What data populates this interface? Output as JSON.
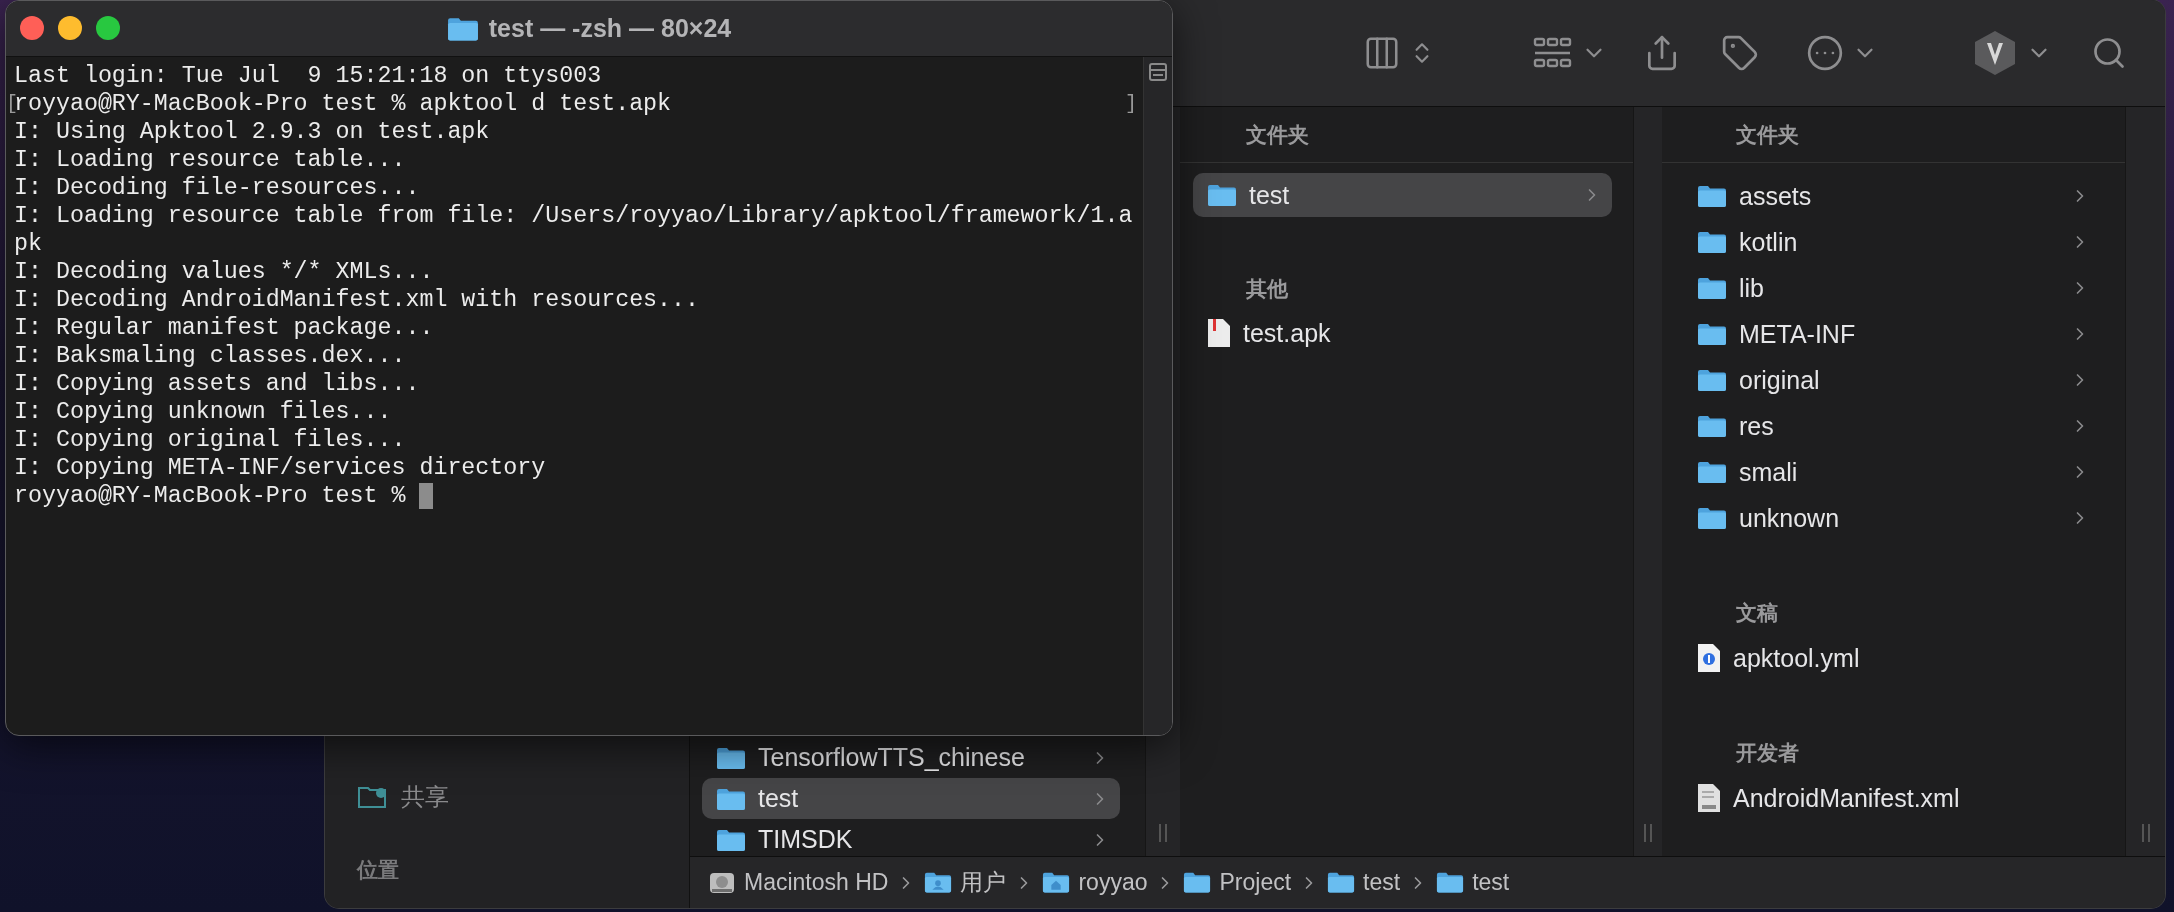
{
  "terminal": {
    "title": "test — -zsh — 80×24",
    "lines": [
      {
        "kind": "output",
        "text": "Last login: Tue Jul  9 15:21:18 on ttys003"
      },
      {
        "kind": "marked",
        "text": "royyao@RY-MacBook-Pro test % apktool d test.apk",
        "mark_open": "[",
        "mark_close": "]"
      },
      {
        "kind": "output",
        "text": "I: Using Apktool 2.9.3 on test.apk"
      },
      {
        "kind": "output",
        "text": "I: Loading resource table..."
      },
      {
        "kind": "output",
        "text": "I: Decoding file-resources..."
      },
      {
        "kind": "output",
        "text": "I: Loading resource table from file: /Users/royyao/Library/apktool/framework/1.apk"
      },
      {
        "kind": "output",
        "text": "I: Decoding values */* XMLs..."
      },
      {
        "kind": "output",
        "text": "I: Decoding AndroidManifest.xml with resources..."
      },
      {
        "kind": "output",
        "text": "I: Regular manifest package..."
      },
      {
        "kind": "output",
        "text": "I: Baksmaling classes.dex..."
      },
      {
        "kind": "output",
        "text": "I: Copying assets and libs..."
      },
      {
        "kind": "output",
        "text": "I: Copying unknown files..."
      },
      {
        "kind": "output",
        "text": "I: Copying original files..."
      },
      {
        "kind": "output",
        "text": "I: Copying META-INF/services directory"
      },
      {
        "kind": "prompt",
        "text": "royyao@RY-MacBook-Pro test % ",
        "cursor": true
      }
    ]
  },
  "finder": {
    "sidebar": [
      {
        "kind": "item",
        "label": "共享"
      },
      {
        "kind": "header",
        "label": "位置"
      }
    ],
    "columns": [
      {
        "sections": [
          {
            "items": [
              {
                "kind": "folder",
                "name": "TensorflowTTS_chinese",
                "selected": false
              },
              {
                "kind": "folder",
                "name": "test",
                "selected": true
              },
              {
                "kind": "folder",
                "name": "TIMSDK",
                "selected": false
              }
            ]
          }
        ]
      },
      {
        "sections": [
          {
            "header": "文件夹",
            "items": [
              {
                "kind": "folder",
                "name": "test",
                "selected": true
              }
            ]
          },
          {
            "header": "其他",
            "items": [
              {
                "kind": "apk",
                "name": "test.apk",
                "selected": false
              }
            ]
          }
        ]
      },
      {
        "sections": [
          {
            "header": "文件夹",
            "items": [
              {
                "kind": "folder",
                "name": "assets",
                "selected": false
              },
              {
                "kind": "folder",
                "name": "kotlin",
                "selected": false
              },
              {
                "kind": "folder",
                "name": "lib",
                "selected": false
              },
              {
                "kind": "folder",
                "name": "META-INF",
                "selected": false
              },
              {
                "kind": "folder",
                "name": "original",
                "selected": false
              },
              {
                "kind": "folder",
                "name": "res",
                "selected": false
              },
              {
                "kind": "folder",
                "name": "smali",
                "selected": false
              },
              {
                "kind": "folder",
                "name": "unknown",
                "selected": false
              }
            ]
          },
          {
            "header": "文稿",
            "items": [
              {
                "kind": "yml",
                "name": "apktool.yml",
                "selected": false
              }
            ]
          },
          {
            "header": "开发者",
            "items": [
              {
                "kind": "xml",
                "name": "AndroidManifest.xml",
                "selected": false
              }
            ]
          }
        ]
      }
    ],
    "path_bar": [
      {
        "kind": "disk",
        "label": "Macintosh HD"
      },
      {
        "kind": "users",
        "label": "用户"
      },
      {
        "kind": "home",
        "label": "royyao"
      },
      {
        "kind": "folder",
        "label": "Project"
      },
      {
        "kind": "folder",
        "label": "test"
      },
      {
        "kind": "folder",
        "label": "test"
      }
    ]
  }
}
